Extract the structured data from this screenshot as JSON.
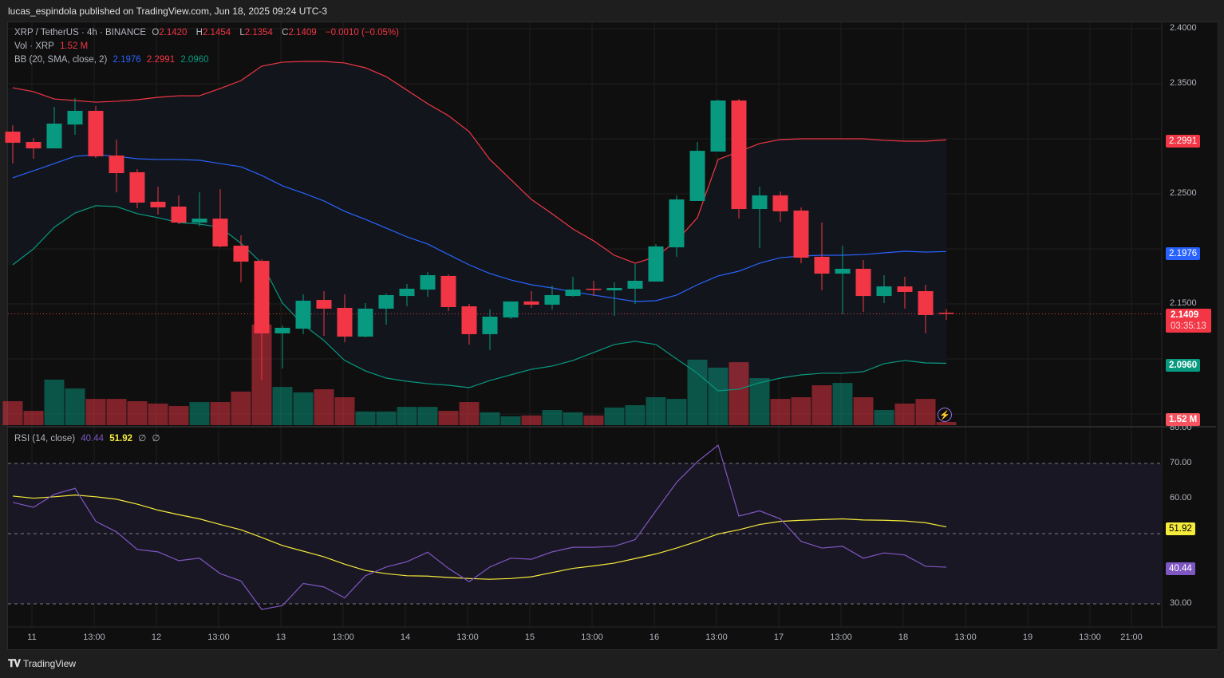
{
  "publish_line": "lucas_espindola published on TradingView.com, Jun 18, 2025 09:24 UTC-3",
  "legend": {
    "symbol": "XRP / TetherUS · 4h · BINANCE",
    "o_label": "O",
    "o": "2.1420",
    "h_label": "H",
    "h": "2.1454",
    "l_label": "L",
    "l": "2.1354",
    "c_label": "C",
    "c": "2.1409",
    "change": "−0.0010 (−0.05%)",
    "vol_label": "Vol · XRP",
    "vol": "1.52 M",
    "bb_label": "BB (20, SMA, close, 2)",
    "bb_basis": "2.1976",
    "bb_upper": "2.2991",
    "bb_lower": "2.0960",
    "rsi_label": "RSI (14, close)",
    "rsi": "40.44",
    "rsi_ma": "51.92",
    "rsi_x1": "∅",
    "rsi_x2": "∅"
  },
  "badges": {
    "bb_upper": "2.2991",
    "bb_basis": "2.1976",
    "last_price": "2.1409",
    "countdown": "03:35:13",
    "bb_lower": "2.0960",
    "volume": "1.52 M",
    "rsi_ma": "51.92",
    "rsi": "40.44"
  },
  "footer": {
    "brand": "TradingView"
  },
  "colors": {
    "up": "#089981",
    "down": "#f23645",
    "bb_upper": "#f23645",
    "bb_basis": "#2962ff",
    "bb_lower": "#089981",
    "rsi": "#7e57c2",
    "rsi_ma": "#f5eb3b"
  },
  "chart_data": [
    {
      "type": "candlestick",
      "title": "XRP / TetherUS 4h BINANCE",
      "ylim": [
        2.05,
        2.4
      ],
      "price_ticks": [
        "2.4000",
        "2.3500",
        "2.2500",
        "2.1500"
      ],
      "x_ticks": [
        "11",
        "13:00",
        "12",
        "13:00",
        "13",
        "13:00",
        "14",
        "13:00",
        "15",
        "13:00",
        "16",
        "13:00",
        "17",
        "13:00",
        "18",
        "13:00",
        "19",
        "13:00",
        "21:00"
      ],
      "candles_ohlcv_millions": [
        [
          2.3065,
          2.3123,
          2.2775,
          2.2964,
          11.4
        ],
        [
          2.2971,
          2.3007,
          2.2819,
          2.2913,
          6.8
        ],
        [
          2.2913,
          2.329,
          2.2913,
          2.3138,
          21.7
        ],
        [
          2.313,
          2.337,
          2.3036,
          2.3254,
          17.5
        ],
        [
          2.3254,
          2.3297,
          2.2826,
          2.2841,
          12.5
        ],
        [
          2.2848,
          2.2993,
          2.2514,
          2.2688,
          12.5
        ],
        [
          2.2696,
          2.2725,
          2.237,
          2.242,
          11.4
        ],
        [
          2.2428,
          2.2565,
          2.2312,
          2.2377,
          10.3
        ],
        [
          2.2384,
          2.2486,
          2.2225,
          2.2239,
          9.1
        ],
        [
          2.2239,
          2.2514,
          2.2203,
          2.2275,
          11.0
        ],
        [
          2.2275,
          2.2543,
          2.2014,
          2.2022,
          11.0
        ],
        [
          2.2029,
          2.2123,
          2.1696,
          2.1884,
          16.0
        ],
        [
          2.1891,
          2.1906,
          2.0812,
          2.1232,
          47.9
        ],
        [
          2.1232,
          2.1304,
          2.0913,
          2.1283,
          18.2
        ],
        [
          2.1275,
          2.1587,
          2.1225,
          2.1529,
          15.6
        ],
        [
          2.1536,
          2.1616,
          2.121,
          2.1457,
          17.1
        ],
        [
          2.1464,
          2.1587,
          2.1152,
          2.1203,
          13.3
        ],
        [
          2.1203,
          2.1507,
          2.1196,
          2.1457,
          6.5
        ],
        [
          2.1457,
          2.1594,
          2.1312,
          2.158,
          6.5
        ],
        [
          2.1572,
          2.1681,
          2.1478,
          2.1638,
          8.7
        ],
        [
          2.163,
          2.179,
          2.1565,
          2.1761,
          8.7
        ],
        [
          2.1754,
          2.1768,
          2.1435,
          2.1471,
          6.8
        ],
        [
          2.1478,
          2.15,
          2.113,
          2.1225,
          11.0
        ],
        [
          2.1225,
          2.1449,
          2.108,
          2.1384,
          6.1
        ],
        [
          2.1377,
          2.1522,
          2.1362,
          2.1522,
          4.2
        ],
        [
          2.1522,
          2.1616,
          2.1464,
          2.1493,
          4.6
        ],
        [
          2.1493,
          2.1667,
          2.1449,
          2.158,
          7.2
        ],
        [
          2.1572,
          2.1746,
          2.1565,
          2.163,
          6.1
        ],
        [
          2.1638,
          2.171,
          2.1572,
          2.163,
          4.6
        ],
        [
          2.1623,
          2.1696,
          2.1391,
          2.1645,
          8.4
        ],
        [
          2.1638,
          2.1862,
          2.15,
          2.171,
          9.5
        ],
        [
          2.1703,
          2.2043,
          2.1703,
          2.2022,
          13.3
        ],
        [
          2.2014,
          2.2486,
          2.1928,
          2.2449,
          12.5
        ],
        [
          2.2435,
          2.2971,
          2.2435,
          2.2891,
          31.2
        ],
        [
          2.2884,
          2.3355,
          2.2884,
          2.3348,
          27.4
        ],
        [
          2.3348,
          2.3362,
          2.2275,
          2.2362,
          30.0
        ],
        [
          2.2362,
          2.2565,
          2.2007,
          2.2486,
          22.4
        ],
        [
          2.2486,
          2.2522,
          2.2246,
          2.2341,
          12.5
        ],
        [
          2.2348,
          2.2377,
          2.187,
          2.192,
          13.3
        ],
        [
          2.1928,
          2.2239,
          2.1623,
          2.1775,
          19.0
        ],
        [
          2.1775,
          2.2029,
          2.1406,
          2.1819,
          20.1
        ],
        [
          2.1819,
          2.1899,
          2.1428,
          2.1572,
          13.3
        ],
        [
          2.1572,
          2.1761,
          2.1507,
          2.1659,
          7.2
        ],
        [
          2.1659,
          2.1746,
          2.1457,
          2.1609,
          10.3
        ],
        [
          2.1616,
          2.1674,
          2.1232,
          2.1399,
          12.5
        ],
        [
          2.142,
          2.1454,
          2.1354,
          2.1409,
          1.52
        ]
      ],
      "bb_upper": [
        2.3464,
        2.3428,
        2.3362,
        2.3348,
        2.3333,
        2.3341,
        2.3355,
        2.3377,
        2.3391,
        2.3391,
        2.3457,
        2.3529,
        2.366,
        2.3696,
        2.3703,
        2.3703,
        2.3689,
        2.3645,
        2.3565,
        2.3442,
        2.3319,
        2.321,
        2.3065,
        2.2812,
        2.2631,
        2.2449,
        2.2319,
        2.2181,
        2.2073,
        2.1942,
        2.187,
        2.1928,
        2.2073,
        2.2283,
        2.2812,
        2.2884,
        2.2957,
        2.2993,
        2.3,
        2.3,
        2.3,
        2.3,
        2.2986,
        2.2978,
        2.2978,
        2.2991
      ],
      "bb_basis": [
        2.2645,
        2.271,
        2.2775,
        2.2841,
        2.2855,
        2.2841,
        2.2819,
        2.2812,
        2.2812,
        2.2805,
        2.2775,
        2.2746,
        2.2667,
        2.2573,
        2.2507,
        2.2435,
        2.2341,
        2.2268,
        2.2189,
        2.2109,
        2.2044,
        2.1949,
        2.1855,
        2.1776,
        2.1718,
        2.1674,
        2.1645,
        2.1609,
        2.158,
        2.1551,
        2.1522,
        2.1529,
        2.158,
        2.1674,
        2.1754,
        2.1797,
        2.187,
        2.192,
        2.1935,
        2.1942,
        2.1942,
        2.1949,
        2.1964,
        2.1978,
        2.1971,
        2.1976
      ],
      "bb_lower": [
        2.1855,
        2.2,
        2.2196,
        2.2326,
        2.2392,
        2.2384,
        2.2319,
        2.2283,
        2.2239,
        2.2225,
        2.2196,
        2.2051,
        2.187,
        2.1507,
        2.1312,
        2.1167,
        2.0986,
        2.0891,
        2.0826,
        2.0797,
        2.0775,
        2.0761,
        2.0739,
        2.0804,
        2.0855,
        2.0906,
        2.0935,
        2.0986,
        2.1058,
        2.1131,
        2.116,
        2.1131,
        2.1,
        2.087,
        2.071,
        2.0725,
        2.0783,
        2.0826,
        2.0855,
        2.087,
        2.087,
        2.0884,
        2.0957,
        2.0986,
        2.0964,
        2.096
      ]
    },
    {
      "type": "line",
      "title": "RSI (14, close)",
      "ylim": [
        25,
        80
      ],
      "y_ticks": [
        "80.00",
        "70.00",
        "60.00",
        "30.00"
      ],
      "bands": [
        30,
        50,
        70
      ],
      "rsi": [
        58.9,
        57.5,
        61.2,
        62.9,
        53.5,
        50.5,
        45.5,
        44.8,
        42.3,
        43.0,
        38.6,
        36.5,
        28.4,
        29.5,
        35.8,
        34.8,
        31.7,
        38.0,
        40.5,
        42.0,
        44.7,
        40.1,
        36.3,
        40.5,
        43.0,
        42.7,
        44.8,
        46.1,
        46.1,
        46.4,
        48.3,
        56.5,
        64.6,
        70.5,
        75.2,
        55.0,
        56.5,
        54.2,
        47.8,
        45.9,
        46.4,
        43.0,
        44.5,
        43.9,
        40.7,
        40.44
      ],
      "rsi_ma": [
        60.7,
        60.1,
        60.5,
        61.0,
        60.5,
        59.8,
        58.4,
        56.7,
        55.4,
        54.2,
        52.6,
        51.1,
        48.9,
        46.6,
        45.0,
        43.4,
        41.3,
        39.5,
        38.6,
        38.0,
        37.9,
        37.5,
        37.2,
        37.0,
        37.2,
        37.7,
        38.9,
        40.1,
        40.8,
        41.6,
        42.9,
        44.2,
        45.9,
        47.8,
        49.9,
        51.1,
        52.6,
        53.5,
        53.8,
        54.0,
        54.2,
        53.9,
        53.8,
        53.6,
        53.1,
        51.92
      ]
    }
  ]
}
